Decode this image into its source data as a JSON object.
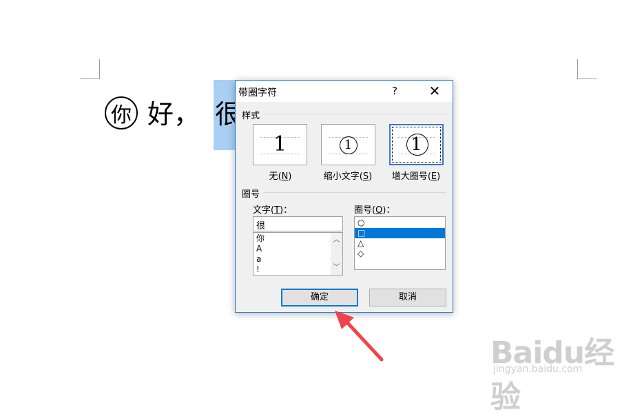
{
  "document": {
    "enclosed_char": "你",
    "text_after": "好，",
    "selected_char": "很"
  },
  "dialog": {
    "title": "带圈字符",
    "help": "?",
    "close": "✕",
    "style_section": "样式",
    "style_options": [
      {
        "glyph": "1",
        "label": "无",
        "key": "N"
      },
      {
        "glyph": "1",
        "label": "缩小文字",
        "key": "S"
      },
      {
        "glyph": "1",
        "label": "增大圈号",
        "key": "E"
      }
    ],
    "enclosure_section": "圈号",
    "text_label": "文字",
    "text_key": "T",
    "text_value": "很",
    "text_list": [
      "你",
      "A",
      "a",
      "!"
    ],
    "enclosure_label": "圈号",
    "enclosure_key": "O",
    "enclosure_list": [
      "○",
      "□",
      "△",
      "◇"
    ],
    "ok_label": "确定",
    "cancel_label": "取消"
  },
  "watermark": {
    "logo": "Baidu经验",
    "url": "jingyan.baidu.com"
  },
  "colors": {
    "accent": "#0078d7",
    "selection": "#a9cff2",
    "arrow": "#f0434b"
  }
}
